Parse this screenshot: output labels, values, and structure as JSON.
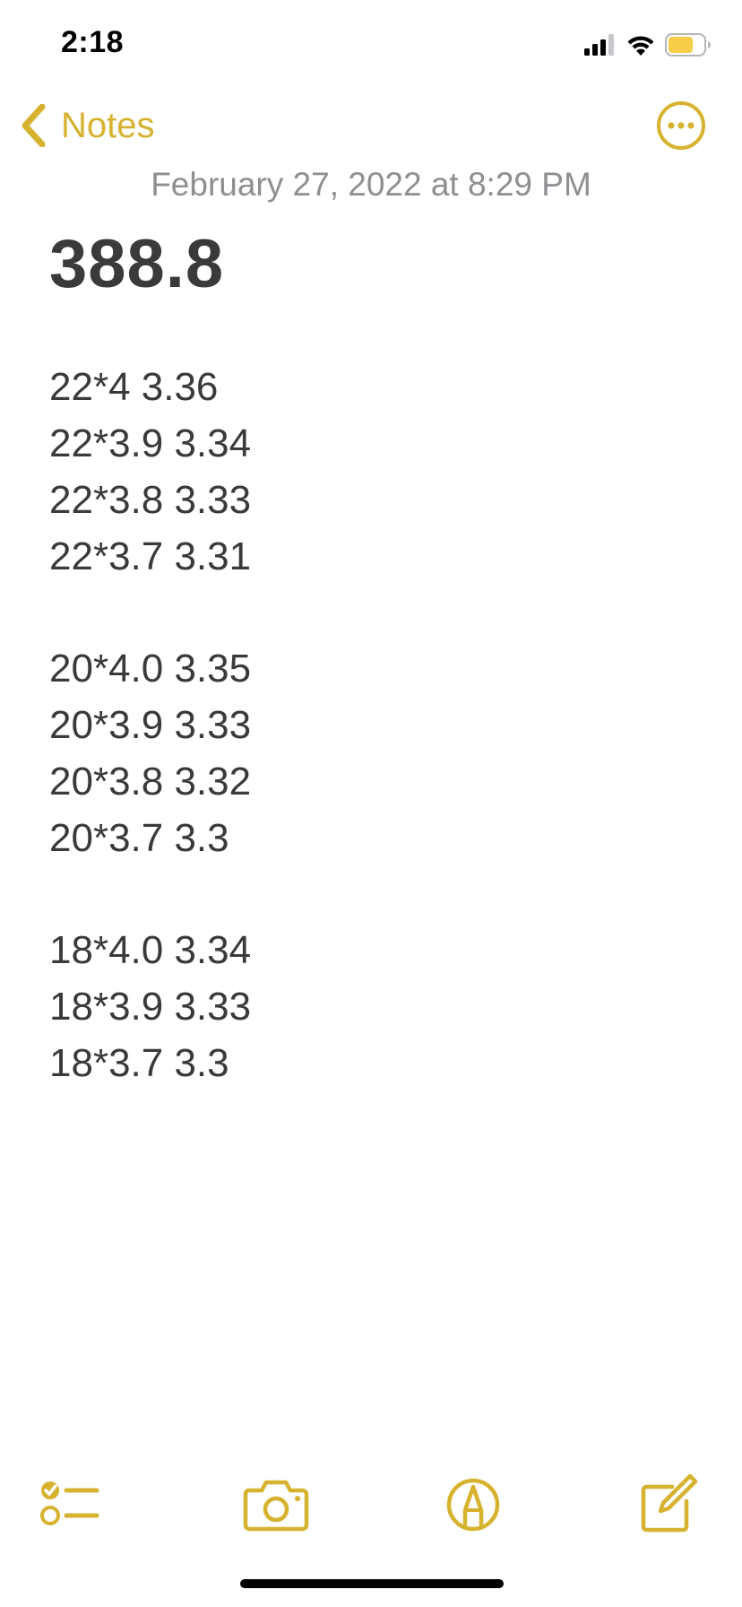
{
  "status_bar": {
    "time": "2:18",
    "icons": [
      "cellular-signal-icon",
      "wifi-icon",
      "battery-icon"
    ]
  },
  "nav": {
    "back_label": "Notes",
    "back_icon": "chevron-left-icon",
    "more_icon": "ellipsis-circle-icon"
  },
  "note": {
    "date": "February 27, 2022 at 8:29 PM",
    "title": "388.8",
    "groups": [
      {
        "lines": [
          "22*4 3.36",
          "22*3.9 3.34",
          "22*3.8 3.33",
          "22*3.7 3.31"
        ]
      },
      {
        "lines": [
          "20*4.0 3.35",
          "20*3.9 3.33",
          "20*3.8 3.32",
          "20*3.7 3.3"
        ]
      },
      {
        "lines": [
          "18*4.0 3.34",
          "18*3.9 3.33",
          "18*3.7 3.3"
        ]
      }
    ]
  },
  "toolbar": {
    "items": [
      "checklist-icon",
      "camera-icon",
      "markup-icon",
      "compose-icon"
    ]
  },
  "colors": {
    "accent": "#d6b22f",
    "text": "#3a3a3c",
    "secondary_text": "#8e8e93",
    "battery_fill": "#f5cd47"
  }
}
